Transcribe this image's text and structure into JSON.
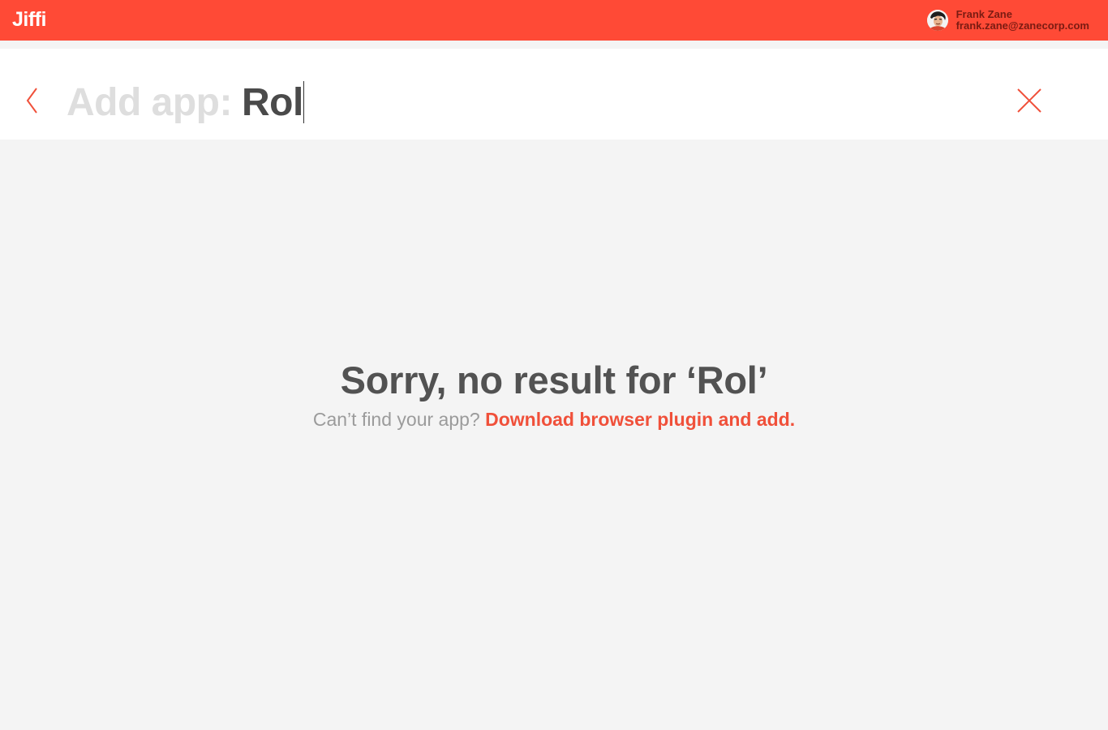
{
  "app": {
    "logo": "Jiffi",
    "brand_color": "#ff4a36"
  },
  "user": {
    "name": "Frank Zane",
    "email": "frank.zane@zanecorp.com",
    "avatar_icon": "user-avatar"
  },
  "search": {
    "prefix": "Add app:",
    "value": "Rol",
    "back_icon": "chevron-left-icon",
    "close_icon": "close-icon"
  },
  "empty_state": {
    "title": "Sorry, no result for ‘Rol’",
    "question": "Can’t find your app?",
    "link_label": "Download browser plugin and add."
  }
}
